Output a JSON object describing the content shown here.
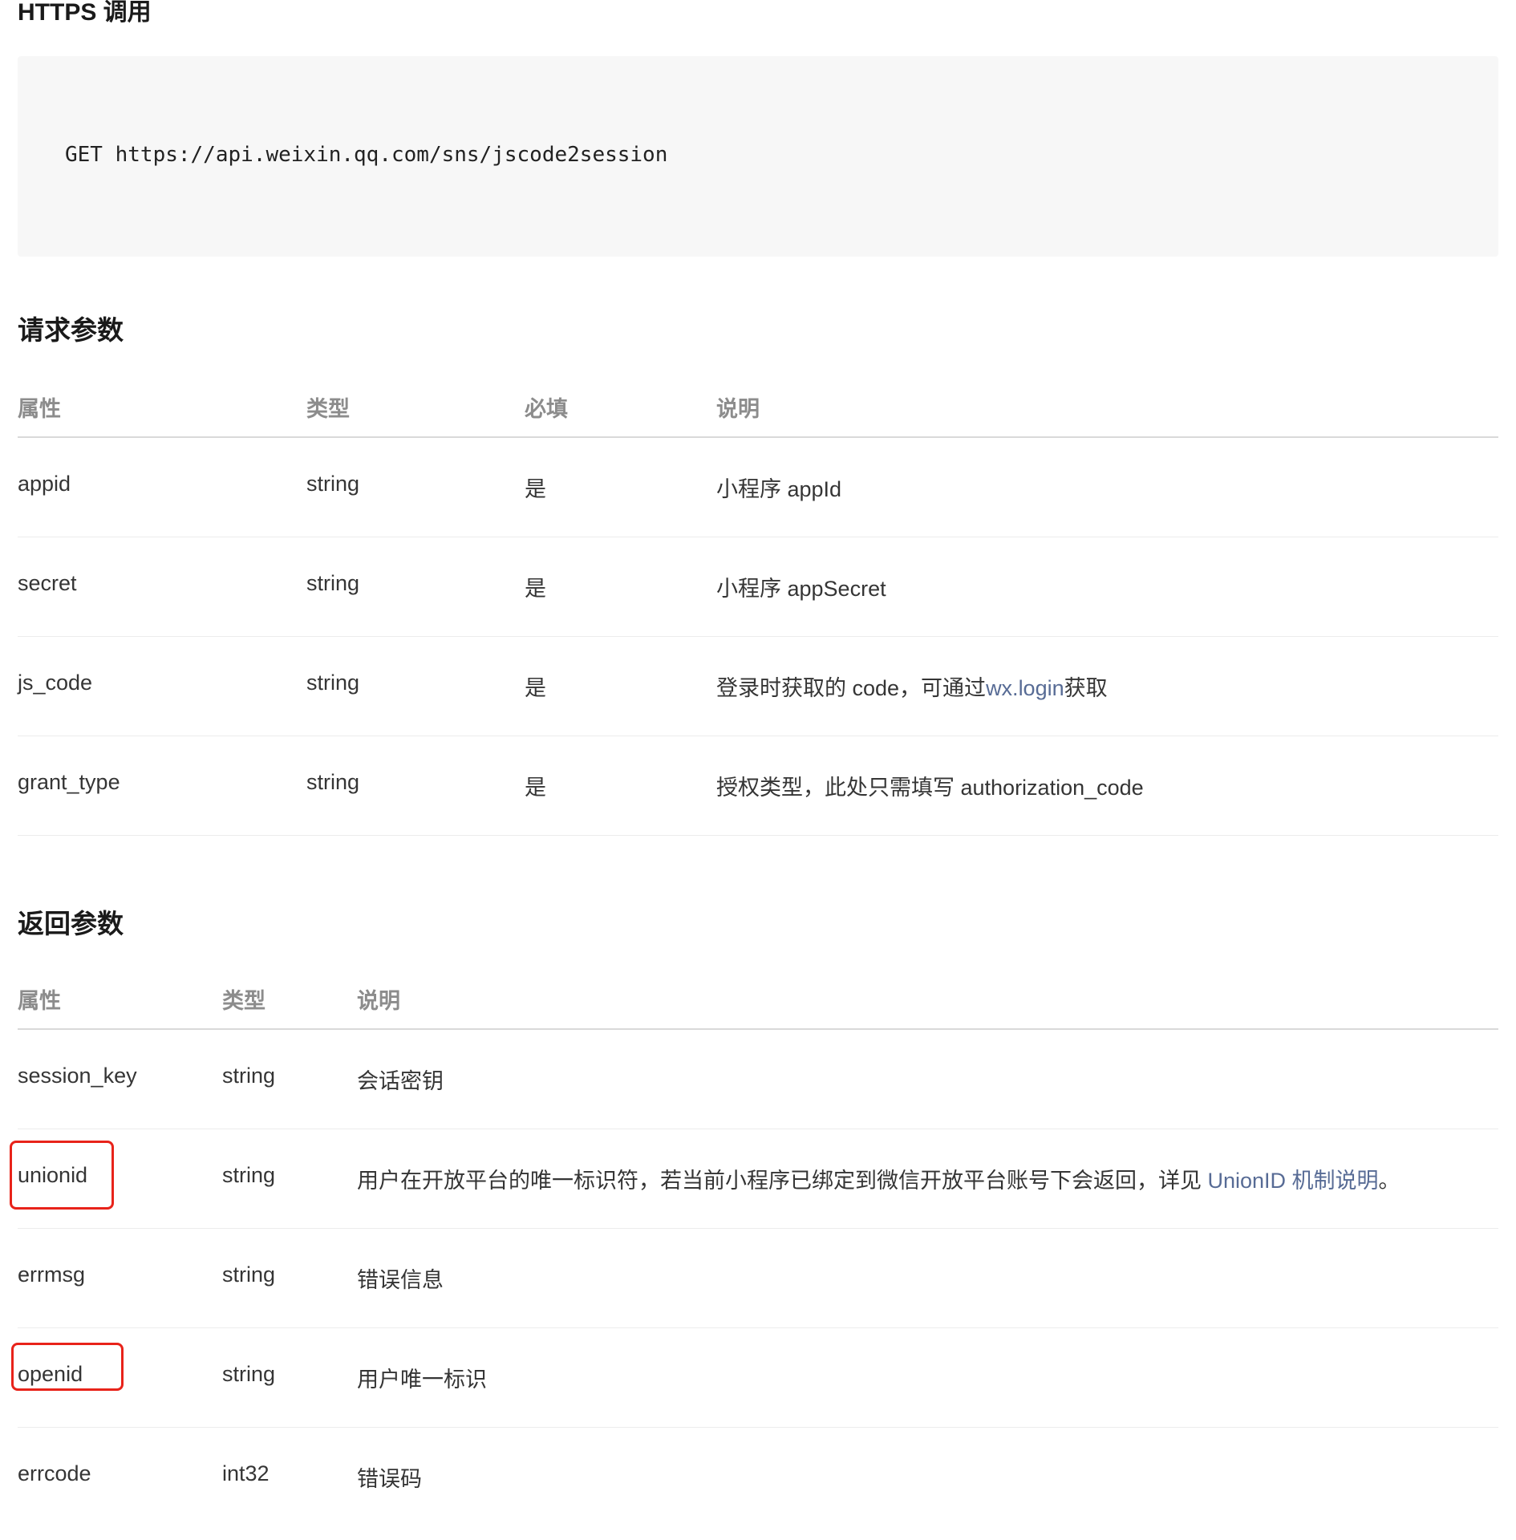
{
  "https_section": {
    "title": "HTTPS 调用",
    "code": "GET https://api.weixin.qq.com/sns/jscode2session"
  },
  "request_section": {
    "title": "请求参数",
    "headers": [
      "属性",
      "类型",
      "必填",
      "说明"
    ],
    "rows": [
      {
        "name": "appid",
        "type": "string",
        "required": "是",
        "desc_before": "小程序 appId",
        "link": "",
        "desc_after": ""
      },
      {
        "name": "secret",
        "type": "string",
        "required": "是",
        "desc_before": "小程序 appSecret",
        "link": "",
        "desc_after": ""
      },
      {
        "name": "js_code",
        "type": "string",
        "required": "是",
        "desc_before": "登录时获取的 code，可通过",
        "link": "wx.login",
        "desc_after": "获取"
      },
      {
        "name": "grant_type",
        "type": "string",
        "required": "是",
        "desc_before": "授权类型，此处只需填写 authorization_code",
        "link": "",
        "desc_after": ""
      }
    ]
  },
  "response_section": {
    "title": "返回参数",
    "headers": [
      "属性",
      "类型",
      "说明"
    ],
    "rows": [
      {
        "name": "session_key",
        "type": "string",
        "desc_before": "会话密钥",
        "link": "",
        "desc_after": "",
        "highlighted": false
      },
      {
        "name": "unionid",
        "type": "string",
        "desc_before": "用户在开放平台的唯一标识符，若当前小程序已绑定到微信开放平台账号下会返回，详见 ",
        "link": "UnionID 机制说明",
        "desc_after": "。",
        "highlighted": true
      },
      {
        "name": "errmsg",
        "type": "string",
        "desc_before": "错误信息",
        "link": "",
        "desc_after": "",
        "highlighted": false
      },
      {
        "name": "openid",
        "type": "string",
        "desc_before": "用户唯一标识",
        "link": "",
        "desc_after": "",
        "highlighted": true
      },
      {
        "name": "errcode",
        "type": "int32",
        "desc_before": "错误码",
        "link": "",
        "desc_after": "",
        "highlighted": false
      }
    ]
  },
  "colors": {
    "link": "#576b95",
    "highlight": "#e8231a",
    "code_bg": "#f7f7f7"
  }
}
